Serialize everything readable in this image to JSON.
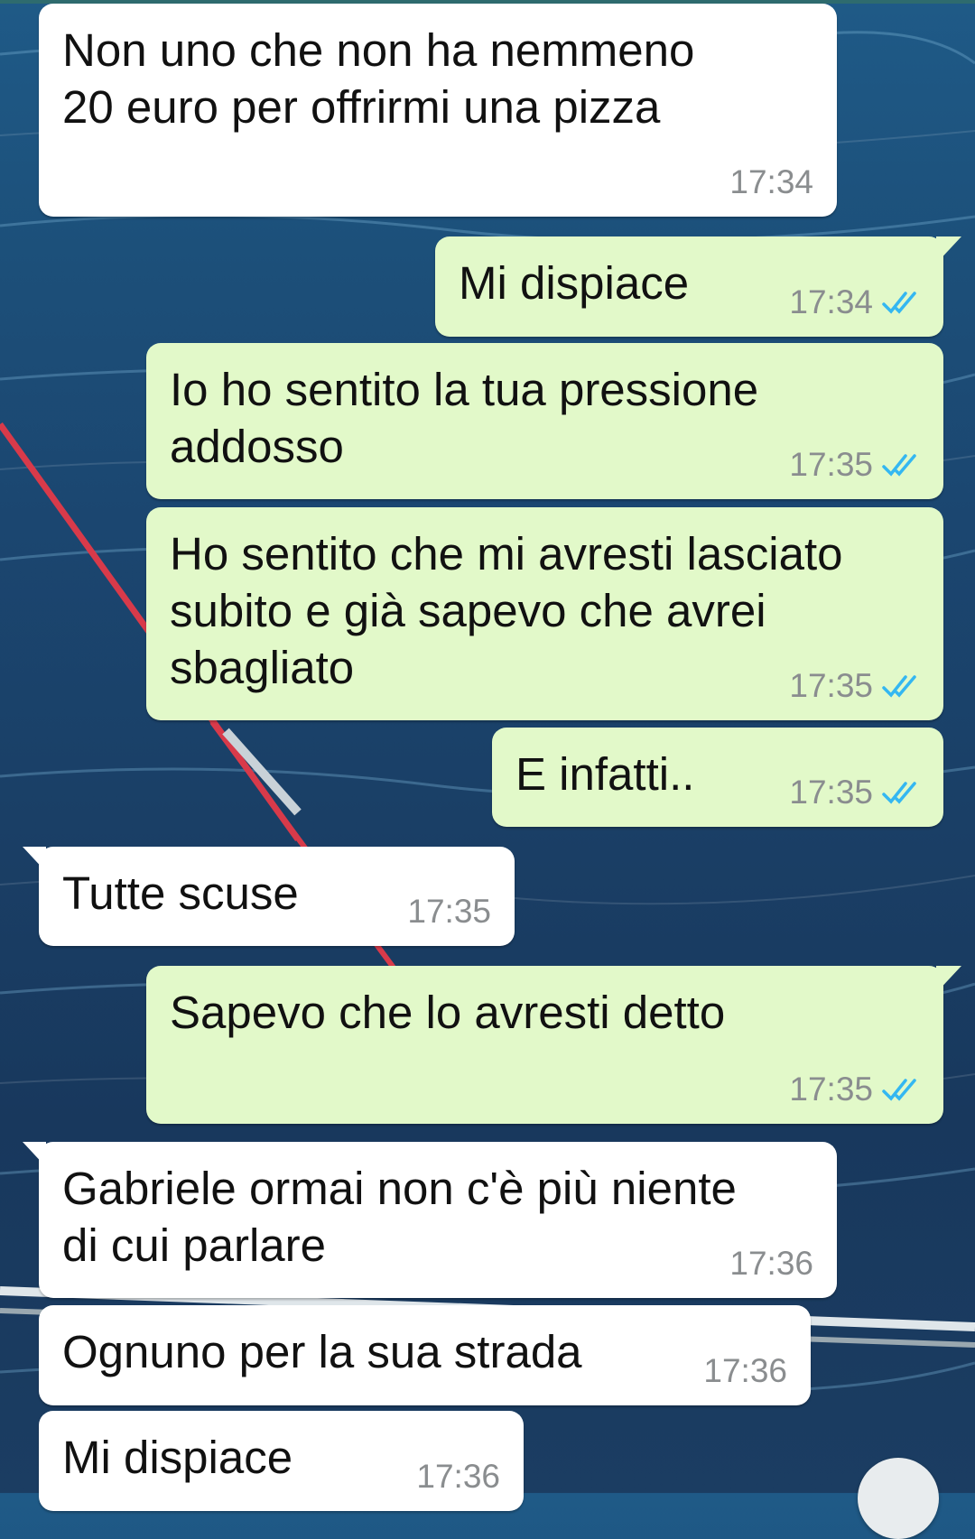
{
  "messages": [
    {
      "dir": "in",
      "text": "Non uno che non ha nemmeno\n20 euro per offrirmi una pizza",
      "time": "17:34"
    },
    {
      "dir": "out",
      "text": "Mi dispiace",
      "time": "17:34",
      "status": "read"
    },
    {
      "dir": "out",
      "text": "Io ho sentito la tua pressione\naddosso",
      "time": "17:35",
      "status": "read"
    },
    {
      "dir": "out",
      "text": "Ho sentito che mi avresti lasciato\nsubito e già sapevo che avrei\nsbagliato",
      "time": "17:35",
      "status": "read"
    },
    {
      "dir": "out",
      "text": "E infatti..",
      "time": "17:35",
      "status": "read"
    },
    {
      "dir": "in",
      "text": "Tutte scuse",
      "time": "17:35"
    },
    {
      "dir": "out",
      "text": "Sapevo che lo avresti detto",
      "time": "17:35",
      "status": "read"
    },
    {
      "dir": "in",
      "text": "Gabriele ormai non c'è più niente\ndi cui parlare",
      "time": "17:36"
    },
    {
      "dir": "in",
      "text": "Ognuno per la sua strada",
      "time": "17:36"
    },
    {
      "dir": "in",
      "text": "Mi dispiace",
      "time": "17:36"
    }
  ],
  "colors": {
    "incoming_bubble": "#ffffff",
    "outgoing_bubble": "#e2f9c9",
    "read_ticks": "#34b7f1",
    "timestamp": "#8a8d8f"
  },
  "icons": {
    "read_status": "double-check-icon",
    "floating_button": "scroll-down-button"
  }
}
